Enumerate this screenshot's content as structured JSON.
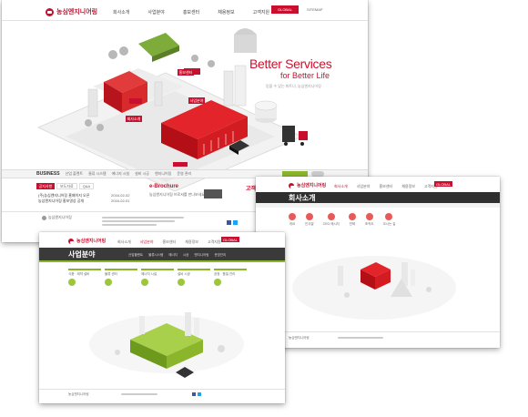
{
  "screen1": {
    "logo_text": "농심엔지니어링",
    "nav": [
      "회사소개",
      "사업분야",
      "홍보센터",
      "채용정보",
      "고객지원"
    ],
    "global_btn": "GLOBAL",
    "sitemap": "SITEMAP",
    "hero_title": "Better Services",
    "hero_subtitle": "for Better Life",
    "hero_caption": "믿을 수 있는 파트너, 농심엔지니어링",
    "labels": {
      "label_a": "홍보센터",
      "label_b": "사업분야",
      "label_c": "회사소개"
    },
    "business_label": "BUSINESS",
    "business_links": [
      "산업 플랜트",
      "물류 시스템",
      "에너지 시설",
      "설비 시공",
      "엔지니어링",
      "운영 관리"
    ],
    "tabs": [
      "공지사항",
      "보도자료",
      "Q&A"
    ],
    "notices": [
      {
        "title": "(주)농심엔지니어링 홈페이지 오픈",
        "date": "2016-02-02"
      },
      {
        "title": "농심엔지니어링 홍보영상 공개",
        "date": "2016-02-01"
      }
    ],
    "ebrochure": "e-Brochure",
    "ebrochure_desc": "농심엔지니어링 브로셔를 만나보세요",
    "customer": "고객지",
    "footer_logo": "농심엔지니어링",
    "colors": {
      "brand": "#c8102e",
      "dark": "#2f2f2f",
      "green": "#8bb52a"
    }
  },
  "screen2": {
    "logo_text": "농심엔지니어링",
    "nav": [
      "회사소개",
      "사업분야",
      "홍보센터",
      "채용정보",
      "고객지원"
    ],
    "global_btn": "GLOBAL",
    "page_title": "회사소개",
    "icons": [
      "개요",
      "인사말",
      "CEO 메시지",
      "연혁",
      "조직도",
      "오시는 길"
    ],
    "footer_text": "농심엔지니어링"
  },
  "screen3": {
    "logo_text": "농심엔지니어링",
    "nav": [
      "회사소개",
      "사업분야",
      "홍보센터",
      "채용정보",
      "고객지원"
    ],
    "global_btn": "GLOBAL",
    "page_title": "사업분야",
    "subnav": [
      "산업플랜트",
      "물류시스템",
      "에너지",
      "시공",
      "엔지니어링",
      "운영관리"
    ],
    "boxes": [
      "식품 · 제약 설비",
      "물류 센터",
      "에너지 시설",
      "설비 시공",
      "공정 · 품질 관리"
    ],
    "footer_text": "농심엔지니어링"
  }
}
